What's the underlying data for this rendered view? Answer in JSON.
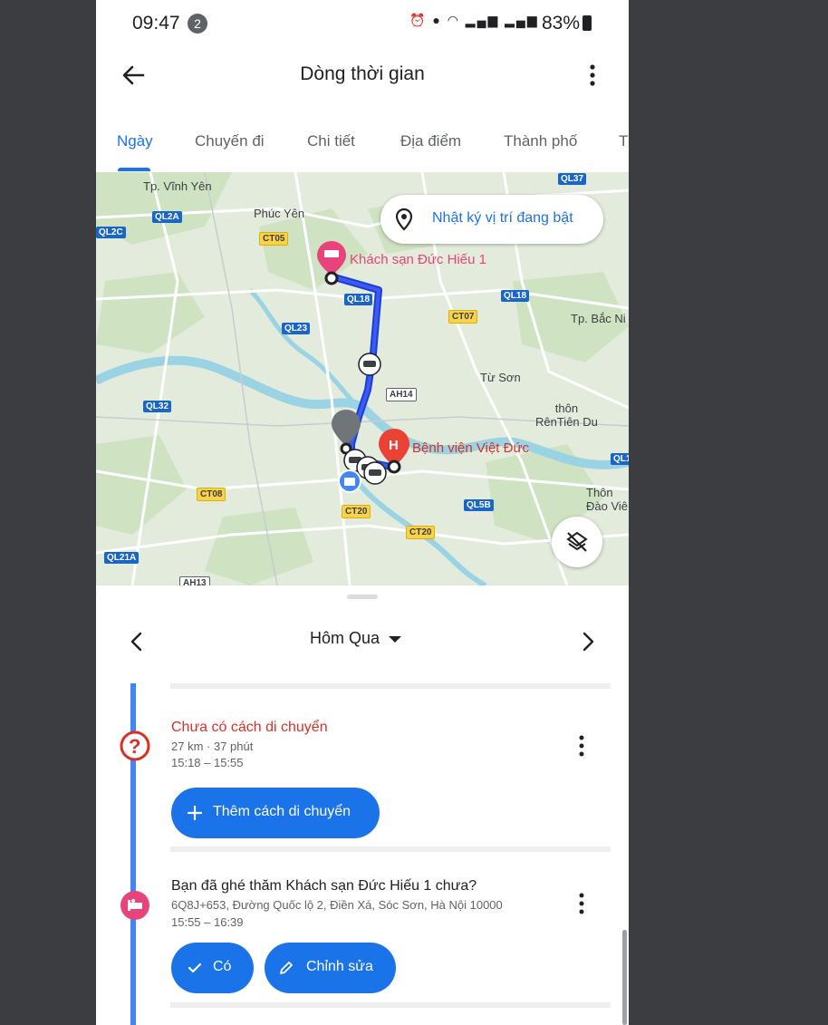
{
  "status_bar": {
    "time": "09:47",
    "notification_count": "2",
    "battery": "83%"
  },
  "app_bar": {
    "title": "Dòng thời gian"
  },
  "tabs": [
    {
      "label": "Ngày",
      "active": true
    },
    {
      "label": "Chuyến đi"
    },
    {
      "label": "Chi tiết"
    },
    {
      "label": "Địa điểm"
    },
    {
      "label": "Thành phố"
    },
    {
      "label": "Th"
    }
  ],
  "map": {
    "location_chip_label": "Nhật ký vị trí đang bật",
    "places": {
      "hotel": "Khách sạn Đức Hiếu 1",
      "hospital": "Bệnh viện Việt Đức",
      "vinh_yen": "Tp. Vĩnh Yên",
      "phuc_yen": "Phúc Yên",
      "bac_ninh": "Tp. Bắc Ni",
      "tu_son": "Từ Sơn",
      "thon_ren_tien_du": "thôn\nRênTiên Du",
      "thon_dao_vien": "Thôn\nĐào Viê"
    },
    "roads": {
      "ql37": "QL37",
      "ql2a": "QL2A",
      "ql2c": "QL2C",
      "ct05": "CT05",
      "ql18a": "QL18",
      "ql18b": "QL18",
      "ct07": "CT07",
      "ql23": "QL23",
      "ah14": "AH14",
      "ql32": "QL32",
      "ql1": "QL1",
      "ct08": "CT08",
      "ql5b": "QL5B",
      "ct20a": "CT20",
      "ct20b": "CT20",
      "ql21a": "QL21A",
      "ah13": "AH13"
    },
    "colors": {
      "route": "#1a44e8",
      "water": "#9ad3e3",
      "land": "#dfe8d9"
    }
  },
  "day_selector": {
    "label": "Hôm Qua"
  },
  "timeline": {
    "items": [
      {
        "title": "Chưa có cách di chuyển",
        "distance_duration": "27 km · 37 phút",
        "time_range": "15:18 – 15:55",
        "action_label": "Thêm cách di chuyển"
      },
      {
        "title": "Bạn đã ghé thăm Khách sạn Đức Hiếu 1 chưa?",
        "address": "6Q8J+653, Đường Quốc lộ 2, Điền Xá, Sóc Sơn, Hà Nội 10000",
        "time_range": "15:55 – 16:39",
        "yes_label": "Có",
        "edit_label": "Chỉnh sửa"
      }
    ]
  }
}
